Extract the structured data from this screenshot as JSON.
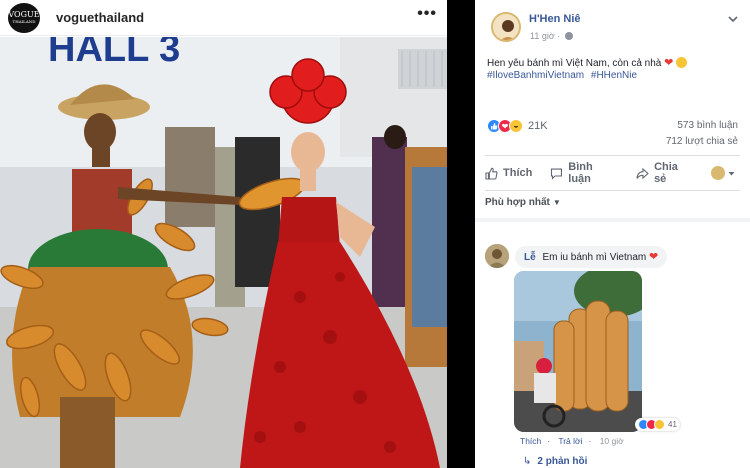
{
  "instagram": {
    "avatar": {
      "line1": "VOGUE",
      "line2": "THAILAND"
    },
    "username": "voguethailand",
    "more_label": "•••",
    "photo_sign": "HALL 3"
  },
  "facebook": {
    "name": "H'Hen Niê",
    "time": "11 giờ",
    "text_line1": "Hen yêu bánh mì Việt Nam, còn cả nhà",
    "hashtags": [
      "#IloveBanhmiVietnam",
      "#HHenNie"
    ],
    "reaction_count": "21K",
    "comments_count": "573 bình luận",
    "shares_count": "712 lượt chia sẻ",
    "actions": {
      "like": "Thích",
      "comment": "Bình luận",
      "share": "Chia sẻ"
    },
    "sort_label": "Phù hợp nhất",
    "comment": {
      "author": "Lễ",
      "text": "Em iu bánh mì Vietnam",
      "reaction_count": "41",
      "like_link": "Thích",
      "reply_link": "Trả lời",
      "time": "10 giờ",
      "replies_label": "2 phản hồi"
    }
  },
  "colors": {
    "fb_link": "#385898",
    "fb_like": "#2d88ff",
    "fb_love": "#f0284a",
    "fb_haha": "#f7c436",
    "ig_text": "#262626"
  }
}
